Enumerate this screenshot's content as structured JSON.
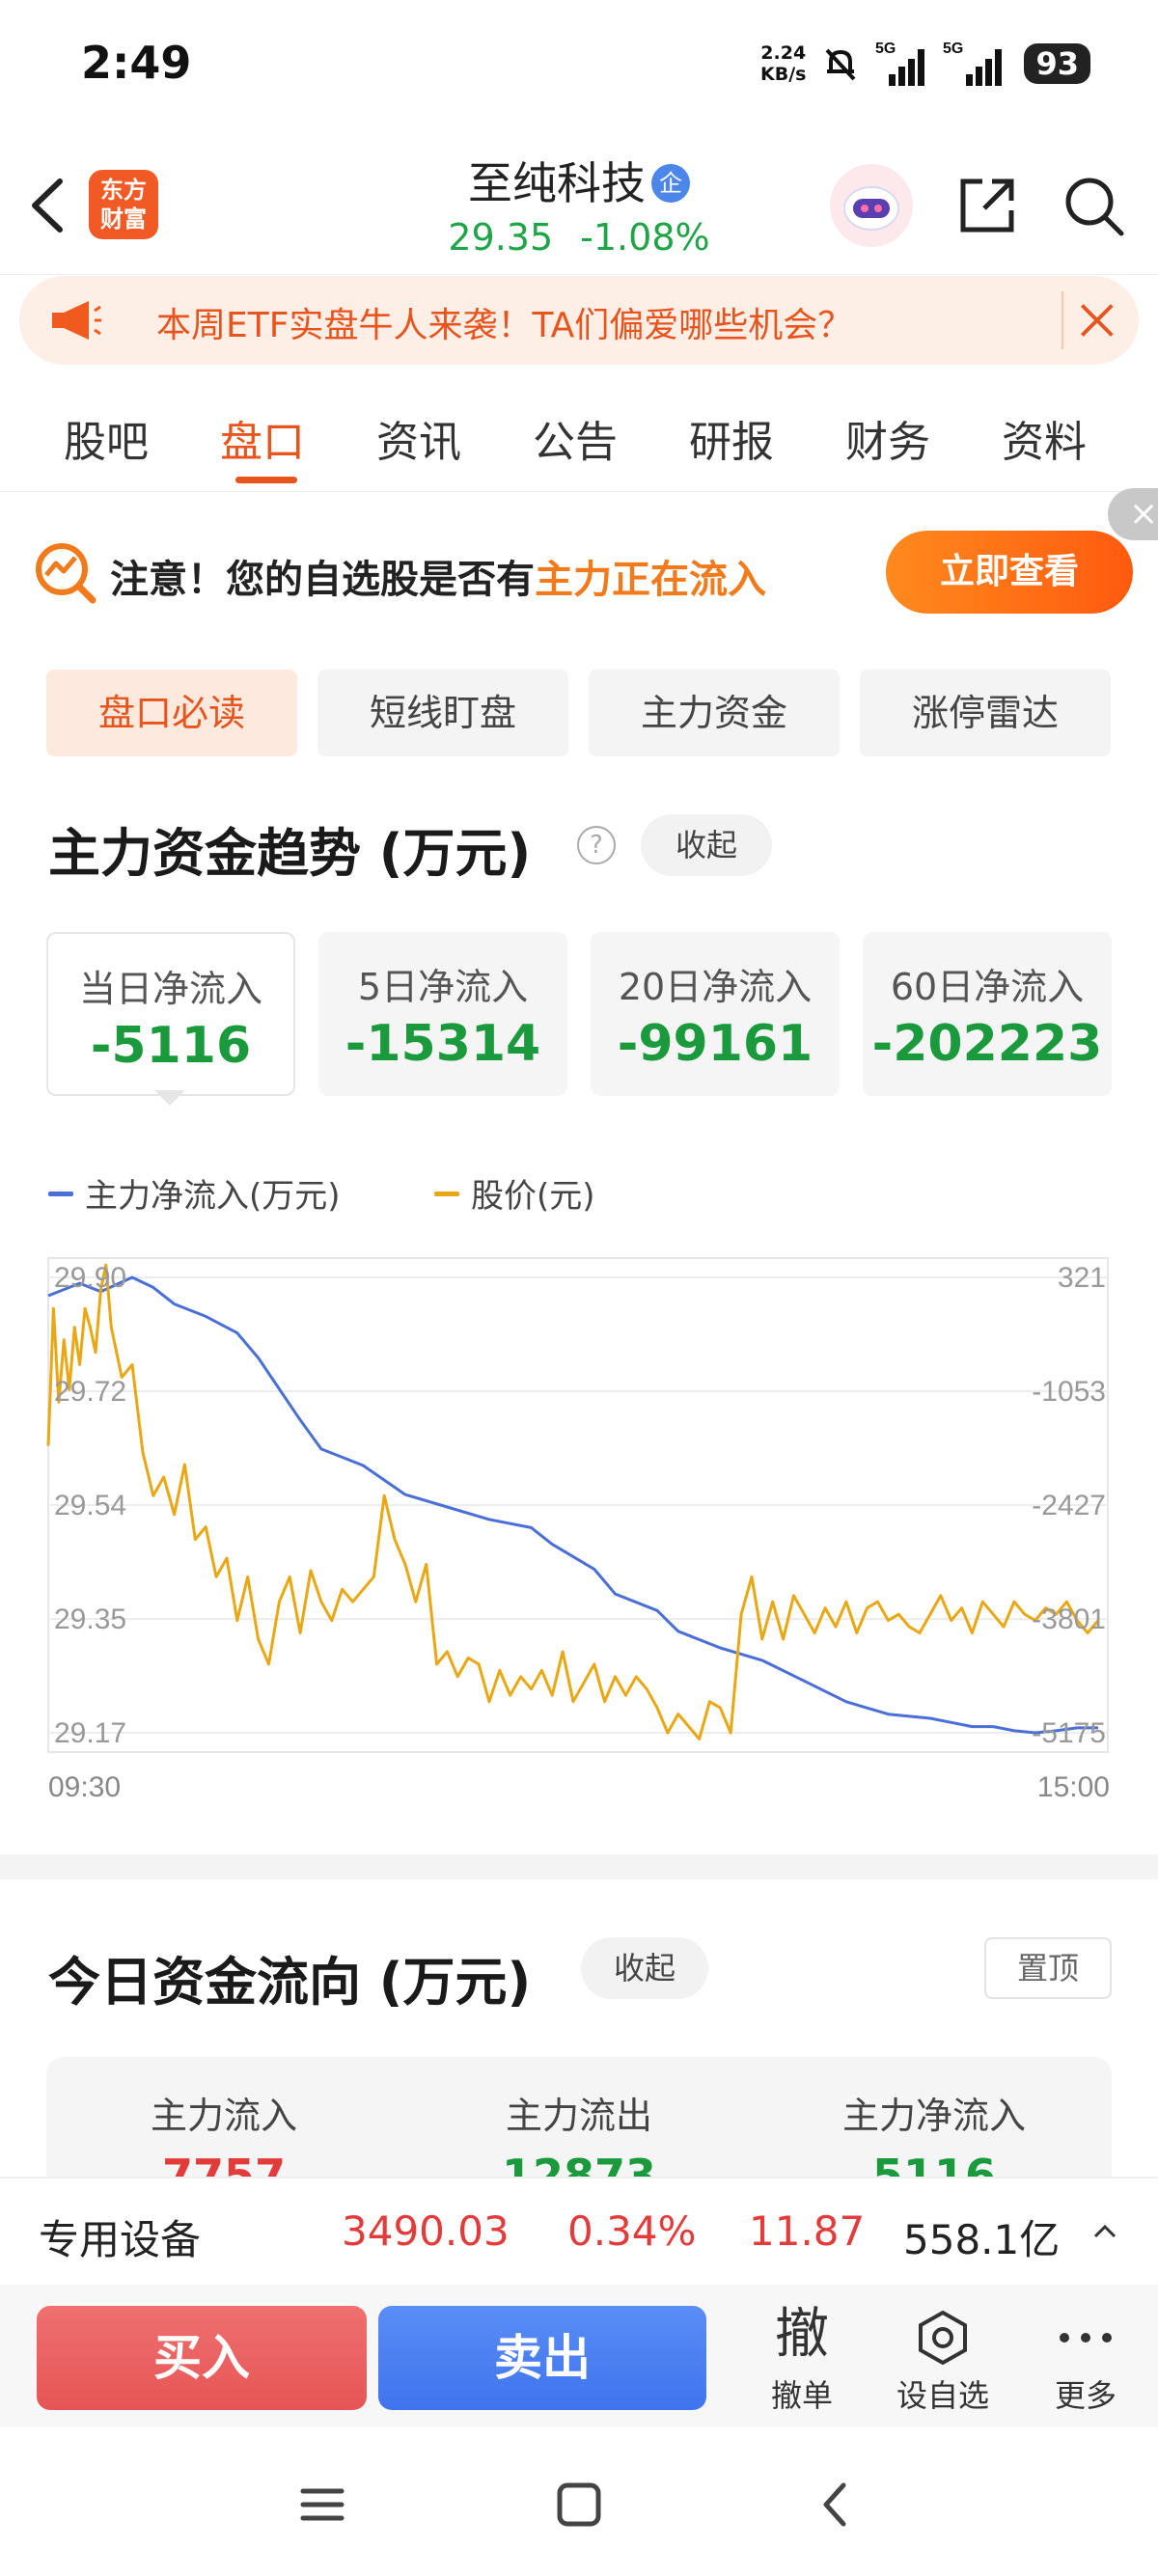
{
  "status_bar": {
    "time": "2:49",
    "net_speed_value": "2.24",
    "net_speed_unit": "KB/s",
    "signal_1": "5G",
    "signal_2": "5G",
    "battery": "93"
  },
  "header": {
    "logo_line1": "东方",
    "logo_line2": "财富",
    "stock_name": "至纯科技",
    "badge": "企",
    "price": "29.35",
    "change_pct": "-1.08%",
    "quote_color": "#1fa548"
  },
  "banner": {
    "text": "本周ETF实盘牛人来袭！TA们偏爱哪些机会？"
  },
  "tabs": [
    "股吧",
    "盘口",
    "资讯",
    "公告",
    "研报",
    "财务",
    "资料"
  ],
  "active_tab": "盘口",
  "notice": {
    "text_prefix": "注意！您的自选股是否有",
    "text_highlight": "主力正在流入",
    "button_label": "立即查看",
    "close_label": "×"
  },
  "segments": [
    "盘口必读",
    "短线盯盘",
    "主力资金",
    "涨停雷达"
  ],
  "fund_trend": {
    "title": "主力资金趋势 (万元)",
    "help": "?",
    "collapse_label": "收起",
    "cards": [
      {
        "label": "当日净流入",
        "value": "-5116"
      },
      {
        "label": "5日净流入",
        "value": "-15314"
      },
      {
        "label": "20日净流入",
        "value": "-99161"
      },
      {
        "label": "60日净流入",
        "value": "-202223"
      }
    ],
    "legend": {
      "series_1": "主力净流入(万元)",
      "series_2": "股价(元)"
    }
  },
  "chart_data": {
    "type": "line",
    "title": "",
    "xlabel": "",
    "ylabel": "",
    "x_ticks": [
      "09:30",
      "15:00"
    ],
    "left_axis_ticks": [
      "29.90",
      "29.72",
      "29.54",
      "29.35",
      "29.17"
    ],
    "right_axis_ticks": [
      "321",
      "-1053",
      "-2427",
      "-3801",
      "-5175"
    ],
    "left_ylim": [
      29.17,
      29.9
    ],
    "right_ylim": [
      -5175,
      321
    ],
    "colors": {
      "net_inflow": "#4a6fd6",
      "price": "#e9a714"
    },
    "series": [
      {
        "name": "主力净流入(万元)",
        "axis": "right",
        "x": [
          0,
          3,
          5,
          8,
          10,
          12,
          15,
          18,
          20,
          24,
          26,
          28,
          30,
          34,
          38,
          42,
          46,
          48,
          52,
          54,
          58,
          60,
          64,
          68,
          72,
          76,
          80,
          84,
          86,
          88,
          90,
          92,
          94,
          96,
          98,
          100
        ],
        "values": [
          100,
          250,
          150,
          321,
          200,
          0,
          -150,
          -350,
          -650,
          -1400,
          -1750,
          -1850,
          -1950,
          -2300,
          -2450,
          -2600,
          -2700,
          -2900,
          -3200,
          -3500,
          -3700,
          -3950,
          -4150,
          -4300,
          -4550,
          -4800,
          -4950,
          -5000,
          -5050,
          -5100,
          -5100,
          -5150,
          -5175,
          -5150,
          -5116,
          -5116
        ]
      },
      {
        "name": "股价(元)",
        "axis": "left",
        "x": [
          0,
          0.5,
          1,
          1.5,
          2,
          2.5,
          3,
          3.5,
          4,
          4.5,
          5,
          5.5,
          6,
          7,
          8,
          9,
          10,
          11,
          12,
          13,
          14,
          15,
          16,
          17,
          18,
          19,
          20,
          21,
          22,
          23,
          24,
          25,
          26,
          27,
          28,
          29,
          30,
          31,
          32,
          33,
          34,
          35,
          36,
          37,
          38,
          39,
          40,
          41,
          42,
          43,
          44,
          45,
          46,
          47,
          48,
          49,
          50,
          51,
          52,
          53,
          54,
          55,
          56,
          57,
          58,
          59,
          60,
          61,
          62,
          63,
          64,
          65,
          66,
          67,
          68,
          69,
          70,
          71,
          72,
          73,
          74,
          75,
          76,
          77,
          78,
          79,
          80,
          81,
          82,
          83,
          84,
          85,
          86,
          87,
          88,
          89,
          90,
          91,
          92,
          93,
          94,
          95,
          96,
          97,
          98,
          99,
          100
        ],
        "values": [
          29.63,
          29.85,
          29.7,
          29.8,
          29.72,
          29.82,
          29.76,
          29.85,
          29.82,
          29.78,
          29.88,
          29.92,
          29.82,
          29.74,
          29.76,
          29.62,
          29.55,
          29.58,
          29.52,
          29.6,
          29.48,
          29.5,
          29.42,
          29.45,
          29.35,
          29.42,
          29.32,
          29.28,
          29.38,
          29.42,
          29.33,
          29.43,
          29.38,
          29.35,
          29.4,
          29.38,
          29.4,
          29.42,
          29.55,
          29.48,
          29.44,
          29.38,
          29.44,
          29.28,
          29.3,
          29.26,
          29.29,
          29.28,
          29.22,
          29.27,
          29.23,
          29.26,
          29.24,
          29.27,
          29.23,
          29.3,
          29.22,
          29.25,
          29.28,
          29.22,
          29.26,
          29.23,
          29.26,
          29.24,
          29.21,
          29.17,
          29.2,
          29.18,
          29.16,
          29.22,
          29.21,
          29.17,
          29.36,
          29.42,
          29.32,
          29.38,
          29.32,
          29.39,
          29.36,
          29.33,
          29.37,
          29.34,
          29.38,
          29.33,
          29.37,
          29.38,
          29.35,
          29.36,
          29.34,
          29.33,
          29.36,
          29.39,
          29.35,
          29.37,
          29.33,
          29.38,
          29.36,
          29.34,
          29.38,
          29.36,
          29.35,
          29.37,
          29.36,
          29.38,
          29.35,
          29.33,
          29.35
        ]
      }
    ]
  },
  "fund_flow": {
    "title": "今日资金流向 (万元)",
    "collapse_label": "收起",
    "pin_label": "置顶",
    "columns": [
      {
        "label": "主力流入",
        "value": "7757",
        "color": "#e33a3a"
      },
      {
        "label": "主力流出",
        "value": "12873",
        "color": "#1a9a3c"
      },
      {
        "label": "主力净流入",
        "value": "5116",
        "color": "#1a9a3c"
      }
    ]
  },
  "sector": {
    "name": "专用设备",
    "index": "3490.03",
    "change_pct": "0.34%",
    "change": "11.87",
    "amount": "558.1亿"
  },
  "actions": {
    "buy_label": "买入",
    "sell_label": "卖出",
    "cancel_glyph": "撤",
    "cancel_label": "撤单",
    "watch_label": "设自选",
    "more_label": "更多"
  }
}
